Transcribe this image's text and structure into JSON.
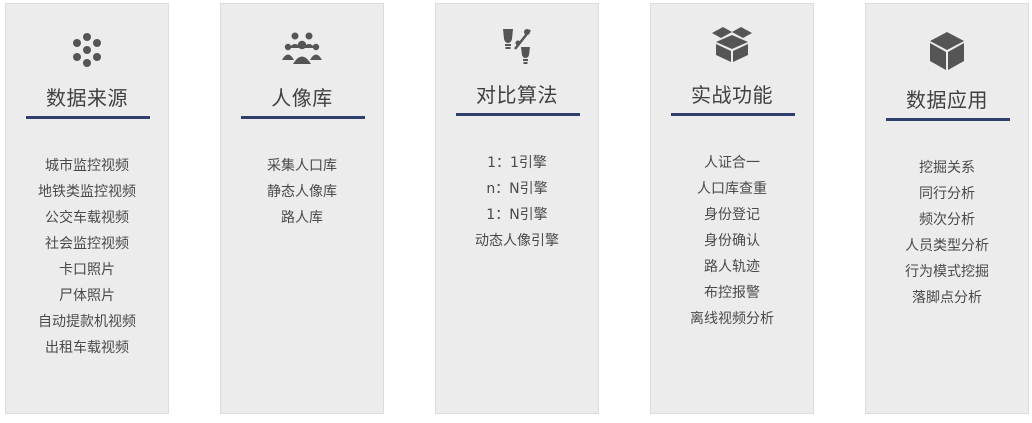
{
  "colors": {
    "card_bg": "#ececec",
    "accent_line": "#2f3f6b",
    "icon": "#555555",
    "text": "#4a4a4a"
  },
  "cards": [
    {
      "icon": "dots-cluster-icon",
      "title": "数据来源",
      "items": [
        "城市监控视频",
        "地铁类监控视频",
        "公交车载视频",
        "社会监控视频",
        "卡口照片",
        "尸体照片",
        "自动提款机视频",
        "出租车载视频"
      ]
    },
    {
      "icon": "people-group-icon",
      "title": "人像库",
      "items": [
        "采集人口库",
        "静态人像库",
        "路人库"
      ]
    },
    {
      "icon": "lightbulb-percent-icon",
      "title": "对比算法",
      "items": [
        "1：1引擎",
        "n：N引擎",
        "1：N引擎",
        "动态人像引擎"
      ]
    },
    {
      "icon": "open-box-icon",
      "title": "实战功能",
      "items": [
        "人证合一",
        "人口库查重",
        "身份登记",
        "身份确认",
        "路人轨迹",
        "布控报警",
        "离线视频分析"
      ]
    },
    {
      "icon": "cube-icon",
      "title": "数据应用",
      "items": [
        "挖掘关系",
        "同行分析",
        "频次分析",
        "人员类型分析",
        "行为模式挖掘",
        "落脚点分析"
      ]
    }
  ]
}
